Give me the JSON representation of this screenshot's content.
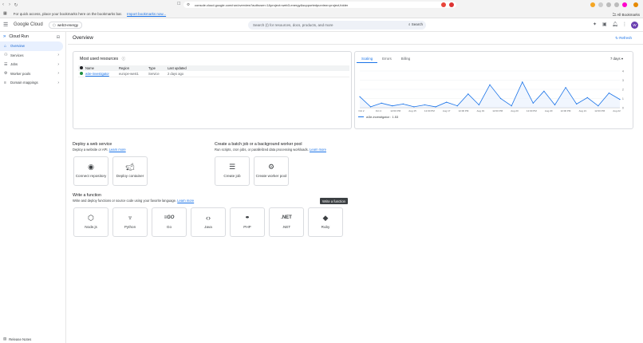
{
  "browser": {
    "url": "console.cloud.google.com/run/overview?authuser=1&project=web3-energy&supportedpurview=project,folder",
    "bookmarks_text": "For quick access, place your bookmarks here on the bookmarks bar.",
    "import_link": "Import bookmarks now...",
    "all_bookmarks": "All Bookmarks"
  },
  "header": {
    "brand": "Google Cloud",
    "project": "web3-energy",
    "search_placeholder": "Search (/) for resources, docs, products, and more",
    "search_button": "Search",
    "avatar_initial": "W"
  },
  "sidebar": {
    "title": "Cloud Run",
    "items": [
      {
        "label": "Overview",
        "icon": "home-icon"
      },
      {
        "label": "Services",
        "icon": "services-icon"
      },
      {
        "label": "Jobs",
        "icon": "jobs-icon"
      },
      {
        "label": "Worker pools",
        "icon": "worker-pools-icon"
      },
      {
        "label": "Domain mappings",
        "icon": "domain-icon"
      }
    ],
    "release_notes": "Release Notes"
  },
  "main": {
    "title": "Overview",
    "refresh": "Refresh",
    "most_used": {
      "title": "Most used resources",
      "columns": [
        "Name",
        "Region",
        "Type",
        "Last updated"
      ],
      "rows": [
        {
          "name": "w3e-investigator",
          "region": "europe-west1",
          "type": "Service",
          "updated": "2 days ago"
        }
      ]
    },
    "chart_panel": {
      "tabs": [
        "Scaling",
        "Errors",
        "Billing"
      ],
      "range": "7 days",
      "legend": "w3e-investigator : 1.53"
    },
    "deploy_web": {
      "title": "Deploy a web service",
      "subtitle": "Deploy a website or API.",
      "learn": "Learn more",
      "tiles": [
        {
          "label": "Connect repository",
          "icon": "github-icon"
        },
        {
          "label": "Deploy container",
          "icon": "docker-icon"
        }
      ]
    },
    "batch": {
      "title": "Create a batch job or a background worker pool",
      "subtitle": "Run scripts, cron jobs, or parallelized data processing workloads.",
      "learn": "Learn more",
      "tiles": [
        {
          "label": "Create job",
          "icon": "job-list-icon"
        },
        {
          "label": "Create worker pool",
          "icon": "gears-icon"
        }
      ]
    },
    "functions": {
      "title": "Write a function",
      "subtitle": "Write and deploy functions or source code using your favorite language.",
      "learn": "Learn more",
      "tiles": [
        {
          "label": "Node.js",
          "icon": "nodejs-icon"
        },
        {
          "label": "Python",
          "icon": "python-icon"
        },
        {
          "label": "Go",
          "icon": "go-icon"
        },
        {
          "label": "Java",
          "icon": "java-icon"
        },
        {
          "label": "PHP",
          "icon": "php-icon"
        },
        {
          "label": ".NET",
          "icon": "dotnet-icon"
        },
        {
          "label": "Ruby",
          "icon": "ruby-icon"
        }
      ],
      "tooltip": "Write a function"
    }
  },
  "chart_data": {
    "type": "line",
    "x": [
      "Oct 2",
      "Oct 4",
      "12:00 PM",
      "Aug 15",
      "12:00 PM",
      "Aug 17",
      "12:00 PM",
      "Aug 19",
      "12:00 PM",
      "Aug 20",
      "12:00 PM",
      "Aug 20",
      "12:00 PM",
      "Aug 21",
      "12:00 PM",
      "Aug 22"
    ],
    "series": [
      {
        "name": "w3e-investigator",
        "values": [
          1.2,
          0.1,
          0.5,
          0.2,
          0.4,
          0.1,
          0.3,
          0.1,
          0.6,
          0.2,
          1.5,
          0.3,
          2.5,
          1.0,
          0.2,
          2.8,
          0.5,
          1.8,
          0.3,
          2.2,
          0.4,
          1.1,
          0.2,
          1.6,
          0.9
        ]
      }
    ],
    "ylabel": "",
    "ylim": [
      0,
      4
    ]
  },
  "colors": {
    "accent": "#1a73e8",
    "sidebar_active": "#e8f0fe"
  }
}
